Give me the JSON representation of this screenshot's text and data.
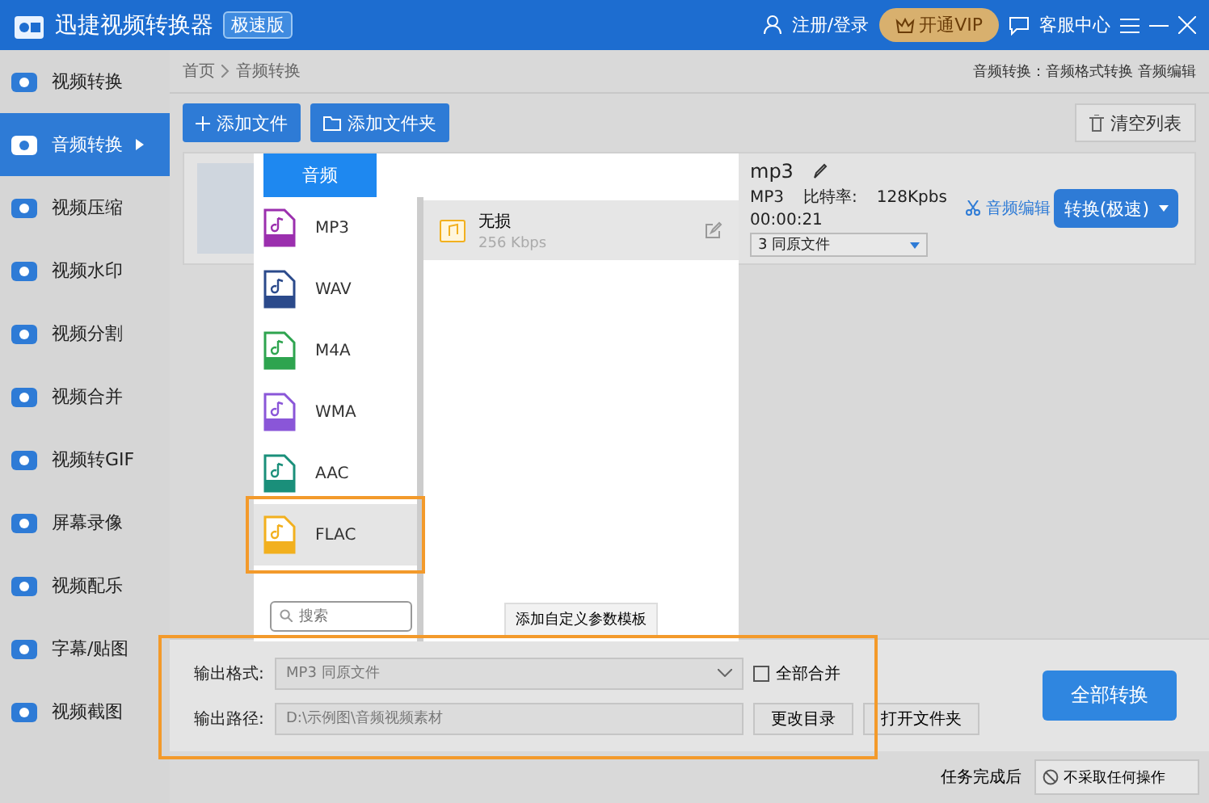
{
  "app": {
    "title": "迅捷视频转换器",
    "edition": "极速版",
    "login": "注册/登录",
    "vip": "开通VIP",
    "service": "客服中心"
  },
  "sidebar": [
    {
      "label": "视频转换",
      "selected": false
    },
    {
      "label": "音频转换",
      "selected": true
    },
    {
      "label": "视频压缩",
      "selected": false
    },
    {
      "label": "视频水印",
      "selected": false
    },
    {
      "label": "视频分割",
      "selected": false
    },
    {
      "label": "视频合并",
      "selected": false
    },
    {
      "label": "视频转GIF",
      "selected": false
    },
    {
      "label": "屏幕录像",
      "selected": false
    },
    {
      "label": "视频配乐",
      "selected": false
    },
    {
      "label": "字幕/贴图",
      "selected": false
    },
    {
      "label": "视频截图",
      "selected": false
    }
  ],
  "breadcrumb": [
    "首页",
    "音频转换"
  ],
  "header_right": "音频转换：音频格式转换 音频编辑",
  "toolbar": {
    "add_file": "添加文件",
    "add_folder": "添加文件夹",
    "clear": "清空列表"
  },
  "file": {
    "name": "mp3",
    "format": "MP3",
    "bitrate_label": "比特率:",
    "bitrate": "128Kpbs",
    "duration": "00:00:21",
    "output": "3  同原文件",
    "edit": "音频编辑",
    "convert": "转换(极速)"
  },
  "popup": {
    "tabs": [
      {
        "label": "音频",
        "selected": true
      }
    ],
    "formats": [
      {
        "label": "MP3",
        "color": "#9b2fae",
        "selected": false
      },
      {
        "label": "WAV",
        "color": "#2b4a8b",
        "selected": false
      },
      {
        "label": "M4A",
        "color": "#2ea44f",
        "selected": false
      },
      {
        "label": "WMA",
        "color": "#8a56d8",
        "selected": false
      },
      {
        "label": "AAC",
        "color": "#1a8f7a",
        "selected": false
      },
      {
        "label": "FLAC",
        "color": "#f2b01e",
        "selected": true
      }
    ],
    "search_placeholder": "搜索",
    "presets": [
      {
        "name": "无损",
        "bitrate": "256 Kbps",
        "selected": true
      }
    ],
    "add_template": "添加自定义参数模板"
  },
  "output": {
    "format_label": "输出格式:",
    "format_value": "MP3  同原文件",
    "merge_all": {
      "label": "全部合并",
      "checked": false
    },
    "path_label": "输出路径:",
    "path_value": "D:\\示例图\\音频视频素材",
    "change_dir": "更改目录",
    "open_folder": "打开文件夹"
  },
  "convert_all": "全部转换",
  "status": {
    "label": "任务完成后",
    "action": "不采取任何操作"
  }
}
